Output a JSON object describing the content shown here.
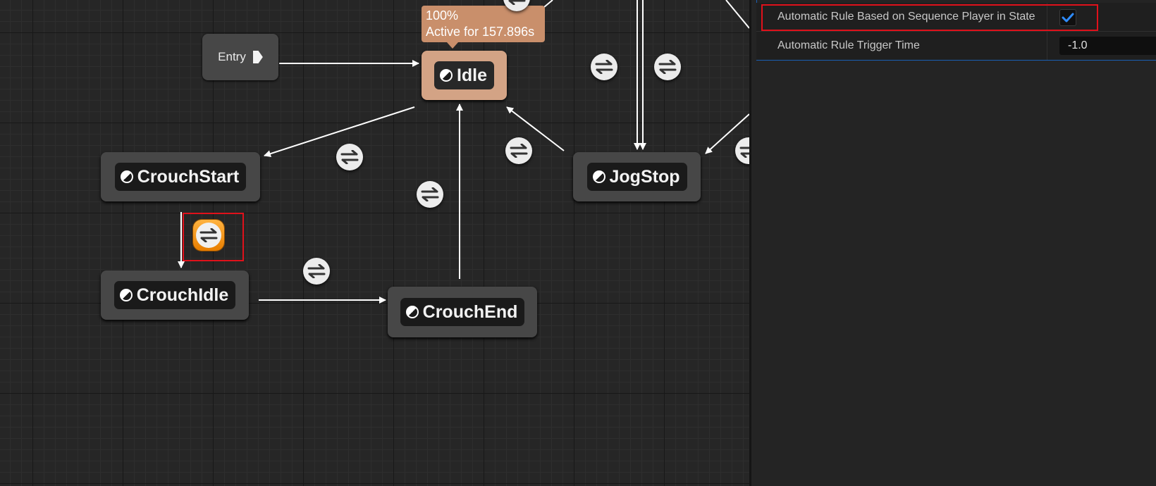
{
  "graph": {
    "entry_label": "Entry",
    "states": {
      "idle": "Idle",
      "crouch_start": "CrouchStart",
      "crouch_idle": "CrouchIdle",
      "crouch_end": "CrouchEnd",
      "jog_stop": "JogStop"
    },
    "active_tooltip": {
      "weight": "100%",
      "active_time": "Active for 157.896s"
    }
  },
  "details": {
    "auto_rule_label": "Automatic Rule Based on Sequence Player in State",
    "auto_rule_checked": true,
    "trigger_time_label": "Automatic Rule Trigger Time",
    "trigger_time_value": "-1.0"
  },
  "colors": {
    "active_state": "#d3a385",
    "selected_transition": "#f59a12",
    "highlight": "#e0111b",
    "checkbox_tick": "#2f8cff"
  },
  "icons": [
    "state-icon",
    "transition-rule-icon",
    "checkmark-icon",
    "entry-arrow-icon"
  ]
}
